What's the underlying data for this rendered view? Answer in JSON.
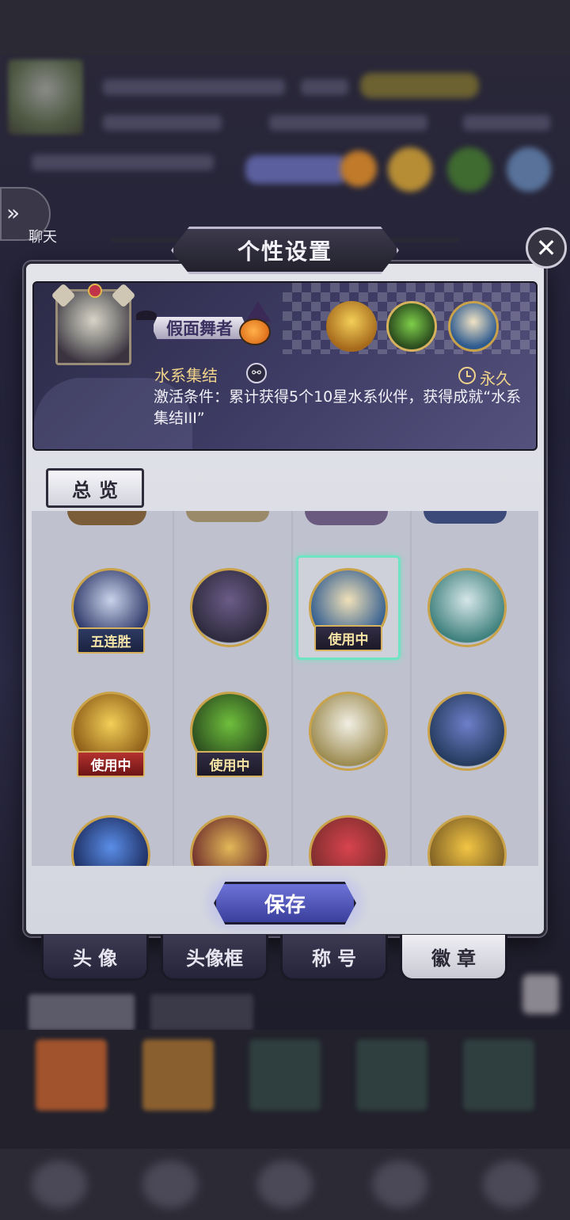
{
  "background": {
    "chat_label": "聊天"
  },
  "modal": {
    "title": "个性设置",
    "close_icon": "close-x-icon"
  },
  "preview": {
    "player_title": "假面舞者",
    "badge_name": "水系集结",
    "duration": "永久",
    "condition": "激活条件：累计获得5个10星水系伙伴，获得成就“水系集结III”"
  },
  "overview_tab": "总览",
  "badges": [
    {
      "name": "five-win-streak-badge",
      "label": "五连胜",
      "ribbon": "blue",
      "colors": [
        "#c9d3ea",
        "#2b3566"
      ],
      "selected": false
    },
    {
      "name": "hooded-knight-badge",
      "label": "",
      "ribbon": "",
      "colors": [
        "#6a5c87",
        "#2e2a3d"
      ],
      "selected": false
    },
    {
      "name": "water-girl-badge",
      "label": "使用中",
      "ribbon": "dark",
      "colors": [
        "#f0e0b8",
        "#2d5a8f"
      ],
      "selected": true
    },
    {
      "name": "sword-wings-badge",
      "label": "",
      "ribbon": "",
      "colors": [
        "#d6e6e9",
        "#3c7f7b"
      ],
      "selected": false
    },
    {
      "name": "golden-knight-badge",
      "label": "使用中",
      "ribbon": "red",
      "colors": [
        "#f3cf58",
        "#8b5b16"
      ],
      "selected": false
    },
    {
      "name": "clover-badge",
      "label": "使用中",
      "ribbon": "dark",
      "colors": [
        "#6fbf3c",
        "#2a4a1e"
      ],
      "selected": false
    },
    {
      "name": "winged-creature-badge",
      "label": "",
      "ribbon": "",
      "colors": [
        "#f1efe4",
        "#9b8a4f"
      ],
      "selected": false
    },
    {
      "name": "octopus-badge",
      "label": "",
      "ribbon": "",
      "colors": [
        "#6e7fc9",
        "#243a5c"
      ],
      "selected": false
    },
    {
      "name": "crystal-orb-badge",
      "label": "",
      "ribbon": "",
      "colors": [
        "#5b8ee8",
        "#1b2a5c"
      ],
      "selected": false
    },
    {
      "name": "magic-lamp-badge",
      "label": "",
      "ribbon": "",
      "colors": [
        "#e2b858",
        "#6b2a2a"
      ],
      "selected": false
    },
    {
      "name": "heart-badge",
      "label": "",
      "ribbon": "",
      "colors": [
        "#d8434d",
        "#7a2d2d"
      ],
      "selected": false
    },
    {
      "name": "moon-badge",
      "label": "",
      "ribbon": "",
      "colors": [
        "#f2c544",
        "#7a5c24"
      ],
      "selected": false
    }
  ],
  "save_label": "保存",
  "tabs": [
    {
      "label": "头像",
      "active": false
    },
    {
      "label": "头像框",
      "active": false
    },
    {
      "label": "称号",
      "active": false
    },
    {
      "label": "徽章",
      "active": true
    }
  ]
}
